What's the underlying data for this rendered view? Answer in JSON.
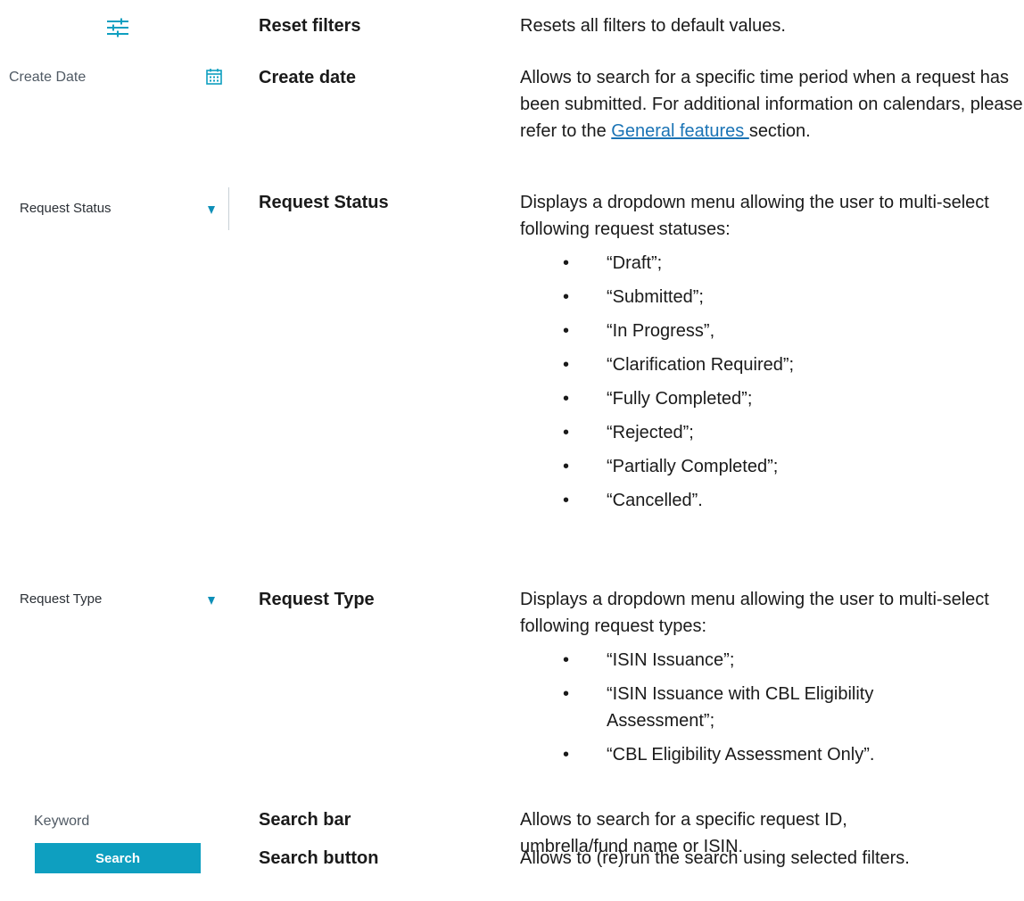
{
  "rows": [
    {
      "name": "Reset filters",
      "description": "Resets all filters to default values."
    },
    {
      "ui_label": "Create Date",
      "name": "Create date",
      "description_before": "Allows to search for a specific time period when a request has been submitted. For additional information on calendars, please refer to the ",
      "link_text": "General features ",
      "description_after": "section."
    },
    {
      "ui_label": "Request Status",
      "name": "Request Status",
      "description": "Displays a dropdown menu allowing the user to multi-select following request statuses:",
      "items": [
        "“Draft”;",
        "“Submitted”;",
        "“In Progress”,",
        "“Clarification Required”;",
        "“Fully Completed”;",
        "“Rejected”;",
        "“Partially Completed”;",
        "“Cancelled”."
      ]
    },
    {
      "ui_label": "Request Type",
      "name": "Request Type",
      "description": "Displays a dropdown menu allowing the user to multi-select following request types:",
      "items": [
        "“ISIN Issuance”;",
        "“ISIN Issuance with CBL Eligibility Assessment”;",
        "“CBL Eligibility Assessment Only”."
      ]
    },
    {
      "ui_label": "Keyword",
      "name": "Search bar",
      "description": "Allows to search for a specific request ID, umbrella/fund name or ISIN."
    },
    {
      "ui_label": "Search",
      "name": "Search button",
      "description": "Allows to (re)run the search using selected filters."
    }
  ],
  "colors": {
    "accent": "#0e9fc0",
    "link": "#1a73b5",
    "label": "#505a64"
  },
  "icons": [
    "filter-sliders-icon",
    "calendar-icon",
    "dropdown-arrow-icon"
  ]
}
